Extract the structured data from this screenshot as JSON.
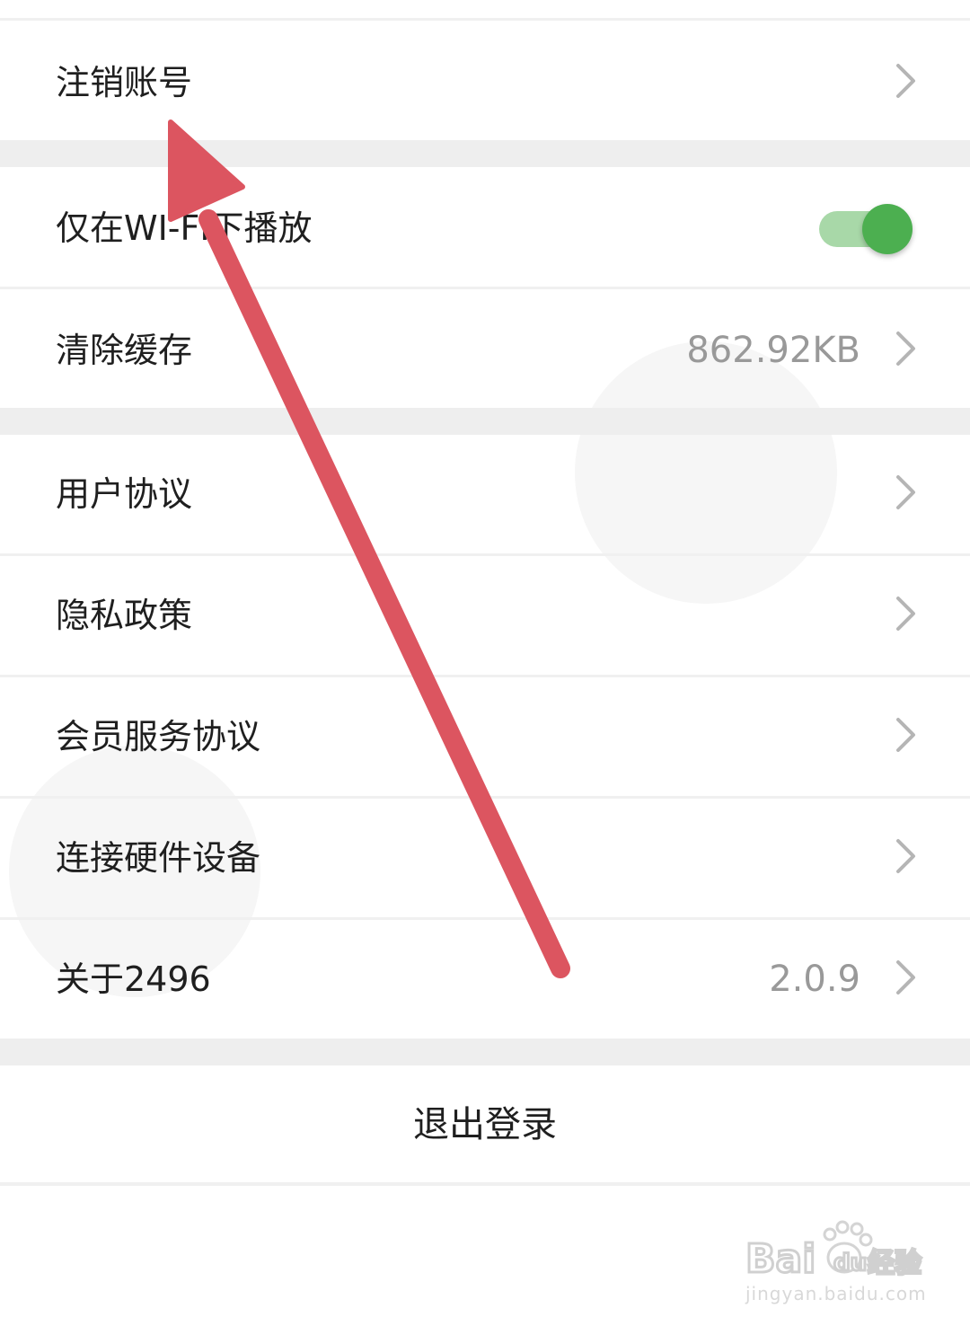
{
  "settings": {
    "items": [
      {
        "label": "注销账号",
        "value": ""
      },
      {
        "label": "仅在WI-FI下播放",
        "value": ""
      },
      {
        "label": "清除缓存",
        "value": "862.92KB"
      },
      {
        "label": "用户协议",
        "value": ""
      },
      {
        "label": "隐私政策",
        "value": ""
      },
      {
        "label": "会员服务协议",
        "value": ""
      },
      {
        "label": "连接硬件设备",
        "value": ""
      },
      {
        "label": "关于2496",
        "value": "2.0.9"
      }
    ],
    "wifi_toggle_on": true,
    "logout_label": "退出登录"
  },
  "colors": {
    "toggle_on": "#4caf50",
    "toggle_track": "#a8d8a8",
    "annotation_arrow": "#dc5560"
  },
  "watermark": {
    "brand": "Bai du 经验",
    "url": "jingyan.baidu.com"
  }
}
